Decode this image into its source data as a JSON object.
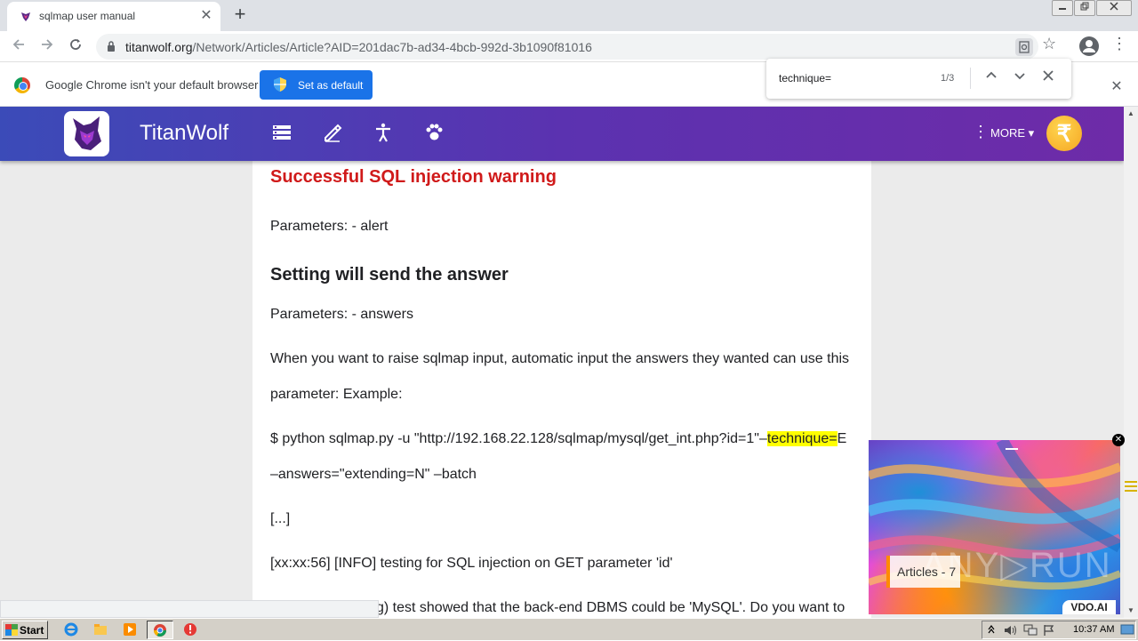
{
  "browser": {
    "tab_title": "sqlmap user manual",
    "tab_close": "✕",
    "new_tab": "+",
    "url_host": "titanwolf.org",
    "url_path": "/Network/Articles/Article?AID=201dac7b-ad34-4bcb-992d-3b1090f81016"
  },
  "infobar": {
    "message": "Google Chrome isn't your default browser",
    "button": "Set as default",
    "close": "✕"
  },
  "findbar": {
    "query": "technique=",
    "count": "1/3"
  },
  "site": {
    "name": "TitanWolf",
    "more": "MORE",
    "coin_symbol": "₹"
  },
  "article": {
    "warning_heading": "Successful SQL injection warning",
    "params_alert": "Parameters: - alert",
    "setting_heading": "Setting will send the answer",
    "params_answers": "Parameters: - answers",
    "para1_line1": "When you want to raise sqlmap input, automatic input the answers they wanted can use this",
    "para1_line2": "parameter: Example:",
    "cmd_before": "$ python sqlmap.py -u \"http://192.168.22.128/sqlmap/mysql/get_int.php?id=1\"–",
    "cmd_highlight": "technique=",
    "cmd_after": "E",
    "cmd_line2": "–answers=\"extending=N\" –batch",
    "ellipsis": "[...]",
    "info_line": "[xx:xx:56] [INFO] testing for SQL injection on GET parameter 'id'",
    "last_line": "g) test showed that the back-end DBMS could be 'MySQL'. Do you want to"
  },
  "ad": {
    "articles_label": "Articles - 7",
    "watermark": "ANY▷RUN",
    "vdo": "VDO.AI",
    "close": "✕"
  },
  "taskbar": {
    "start": "Start",
    "clock": "10:37 AM"
  },
  "colors": {
    "warning_red": "#d01a1a",
    "chrome_blue": "#1a73e8",
    "highlight": "#ffff00"
  }
}
